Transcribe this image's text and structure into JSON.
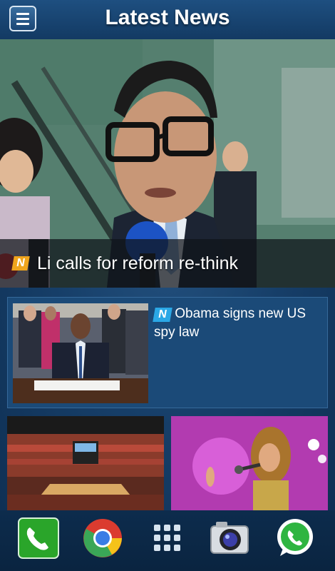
{
  "header": {
    "title": "Latest News",
    "menu_icon": "hamburger-menu-icon"
  },
  "hero": {
    "badge": "N",
    "headline": "Li calls for reform re-think"
  },
  "story": {
    "badge": "N",
    "title": "Obama signs new US spy law"
  },
  "tiles": [
    {
      "image": "basketball-arena-photo"
    },
    {
      "image": "singer-on-stage-photo"
    }
  ],
  "dock": {
    "apps": [
      "phone-icon",
      "chrome-icon",
      "app-drawer-icon",
      "camera-icon",
      "whatsapp-icon"
    ]
  },
  "colors": {
    "header_top": "#1e4f80",
    "background": "#163e68",
    "badge_orange": "#f0a51c",
    "badge_blue": "#2ba8e6"
  }
}
